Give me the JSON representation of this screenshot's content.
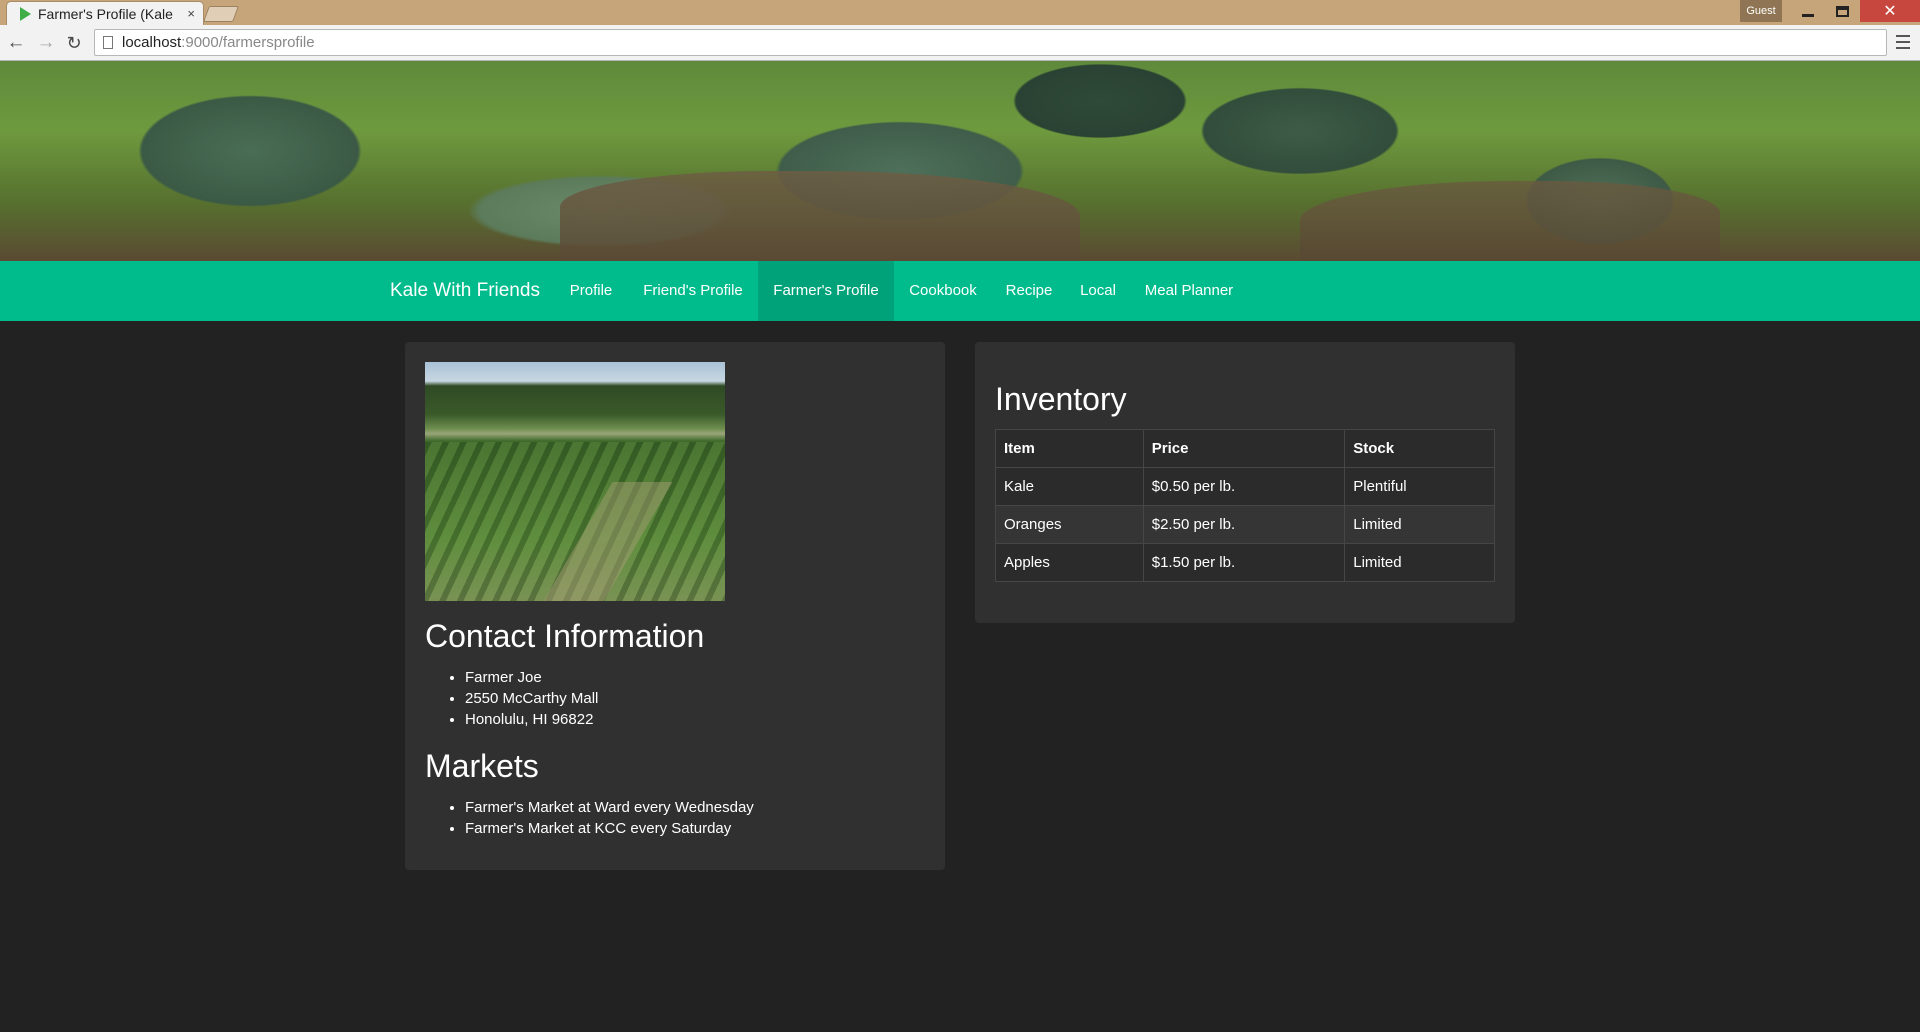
{
  "browser": {
    "tab_title": "Farmer's Profile (Kale",
    "tab_close": "×",
    "profile_label": "Guest",
    "close_glyph": "✕",
    "url_host": "localhost",
    "url_path": ":9000/farmersprofile",
    "icons": [
      "back-arrow-icon",
      "forward-arrow-icon",
      "reload-icon",
      "page-icon",
      "menu-icon"
    ]
  },
  "navbar": {
    "brand": "Kale With Friends",
    "items": [
      {
        "label": "Profile",
        "active": false
      },
      {
        "label": "Friend's Profile",
        "active": false
      },
      {
        "label": "Farmer's Profile",
        "active": true
      },
      {
        "label": "Cookbook",
        "active": false
      },
      {
        "label": "Recipe",
        "active": false
      },
      {
        "label": "Local",
        "active": false
      },
      {
        "label": "Meal Planner",
        "active": false
      }
    ],
    "color": "#00bc8c",
    "active_color": "#00a379"
  },
  "contact": {
    "heading": "Contact Information",
    "items": [
      "Farmer Joe",
      "2550 McCarthy Mall",
      "Honolulu, HI 96822"
    ]
  },
  "markets": {
    "heading": "Markets",
    "items": [
      "Farmer's Market at Ward every Wednesday",
      "Farmer's Market at KCC every Saturday"
    ]
  },
  "inventory": {
    "heading": "Inventory",
    "columns": [
      "Item",
      "Price",
      "Stock"
    ],
    "rows": [
      [
        "Kale",
        "$0.50 per lb.",
        "Plentiful"
      ],
      [
        "Oranges",
        "$2.50 per lb.",
        "Limited"
      ],
      [
        "Apples",
        "$1.50 per lb.",
        "Limited"
      ]
    ]
  },
  "colors": {
    "page_background": "#222222",
    "panel_background": "#303030"
  }
}
